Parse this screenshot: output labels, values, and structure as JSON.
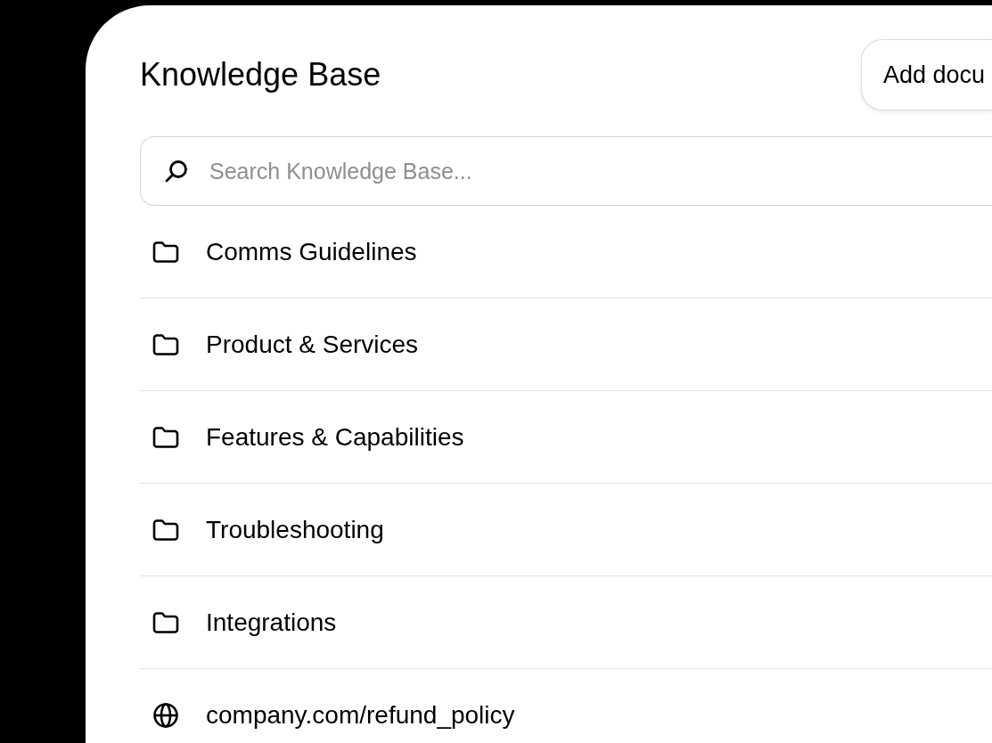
{
  "header": {
    "title": "Knowledge Base",
    "add_button": "Add docu"
  },
  "search": {
    "placeholder": "Search Knowledge Base..."
  },
  "items": [
    {
      "kind": "folder",
      "label": "Comms Guidelines"
    },
    {
      "kind": "folder",
      "label": "Product & Services"
    },
    {
      "kind": "folder",
      "label": "Features & Capabilities"
    },
    {
      "kind": "folder",
      "label": "Troubleshooting"
    },
    {
      "kind": "folder",
      "label": "Integrations"
    },
    {
      "kind": "link",
      "label": "company.com/refund_policy"
    }
  ]
}
